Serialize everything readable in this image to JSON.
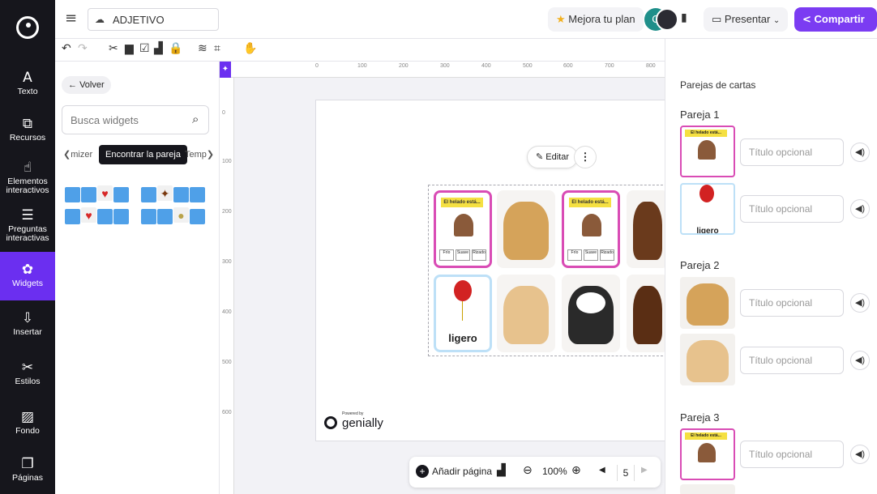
{
  "app": {
    "doc_title": "ADJETIVO"
  },
  "rail": {
    "items": [
      {
        "label": "Texto",
        "icon": "text-icon",
        "glyph": "A"
      },
      {
        "label": "Recursos",
        "icon": "resources-icon",
        "glyph": "⧉"
      },
      {
        "label": "Elementos interactivos",
        "icon": "pointer-icon",
        "glyph": "☝"
      },
      {
        "label": "Preguntas interactivas",
        "icon": "questions-icon",
        "glyph": "☰"
      },
      {
        "label": "Widgets",
        "icon": "puzzle-icon",
        "glyph": "✿"
      },
      {
        "label": "Insertar",
        "icon": "insert-icon",
        "glyph": "⇩"
      },
      {
        "label": "Estilos",
        "icon": "styles-icon",
        "glyph": "✂"
      },
      {
        "label": "Fondo",
        "icon": "background-icon",
        "glyph": "▨"
      },
      {
        "label": "Páginas",
        "icon": "pages-icon",
        "glyph": "❐"
      }
    ]
  },
  "header": {
    "upgrade": "Mejora tu plan",
    "present": "Presentar",
    "share": "Compartir",
    "avatar_initial": "C"
  },
  "panel": {
    "back": "Volver",
    "search_placeholder": "Busca widgets",
    "chip_left": "mizer",
    "chip_active": "Encontrar la pareja",
    "chip_right": "Temp"
  },
  "ruler": {
    "h": [
      "0",
      "100",
      "200",
      "300",
      "400",
      "500",
      "600",
      "700",
      "800"
    ],
    "v": [
      "0",
      "100",
      "200",
      "300",
      "400",
      "500",
      "600"
    ]
  },
  "canvas": {
    "edit_label": "Editar",
    "card_title": "El helado está...",
    "card_options": [
      "Frío",
      "Suave",
      "Rizado"
    ],
    "balloon_word": "ligero",
    "powered_by": "Powered by",
    "brand": "genially"
  },
  "right": {
    "title": "Parejas de cartas",
    "pairs": [
      {
        "title": "Pareja 1",
        "placeholders": [
          "Título opcional",
          "Título opcional"
        ]
      },
      {
        "title": "Pareja 2",
        "placeholders": [
          "Título opcional",
          "Título opcional"
        ]
      },
      {
        "title": "Pareja 3",
        "placeholders": [
          "Título opcional"
        ]
      }
    ],
    "balloon_word_partial": "ligero"
  },
  "bottom": {
    "add_page": "Añadir página",
    "zoom": "100%",
    "page": "5"
  },
  "colors": {
    "accent": "#6b2ff0",
    "share": "#7b3cf2",
    "card_border": "#d94cb5",
    "tile_blue": "#4fa0e8"
  }
}
